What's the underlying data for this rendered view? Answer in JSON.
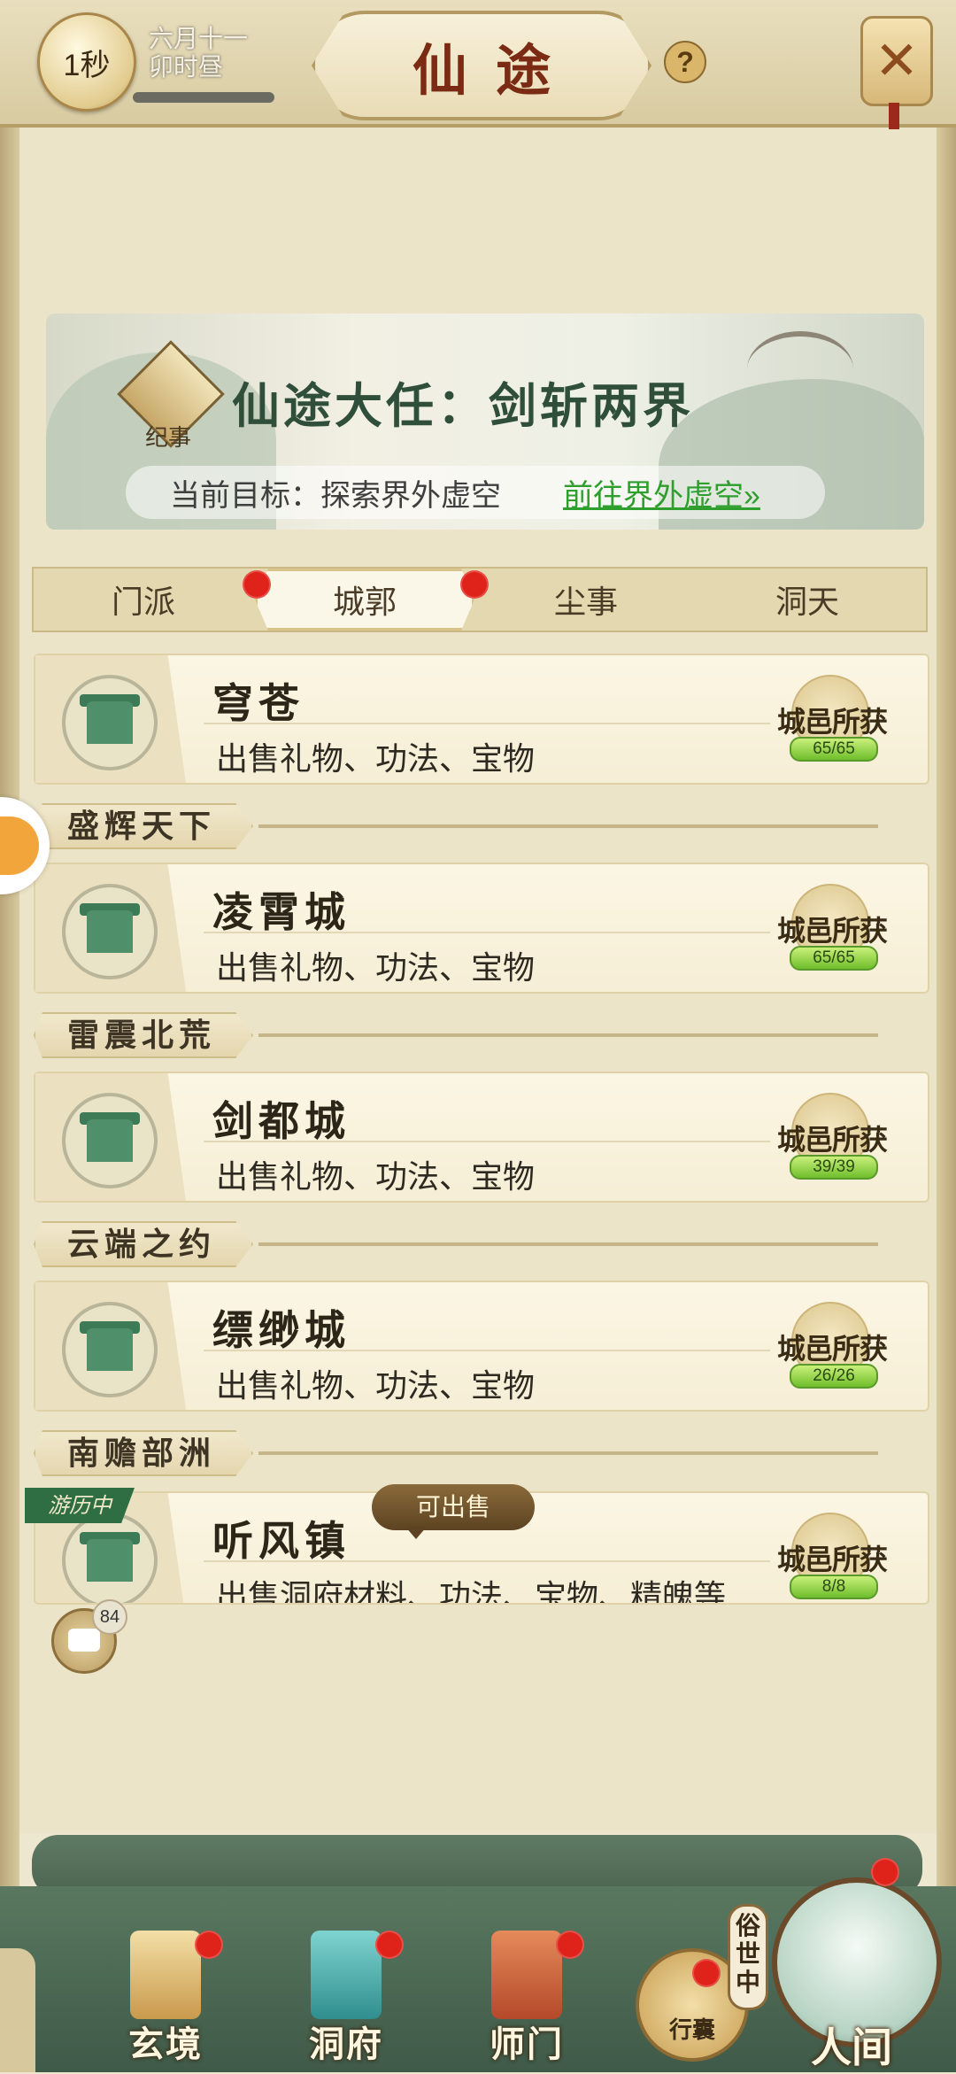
{
  "header": {
    "timer": "1秒",
    "date_line1": "六月十一",
    "date_line2": "卯时昼",
    "title": "仙途",
    "help_icon": "?",
    "close_icon": "✕"
  },
  "quest": {
    "badge": "纪事",
    "title": "仙途大任：剑斩两界",
    "goal_label": "当前目标：探索界外虚空",
    "goal_link": "前往界外虚空»"
  },
  "tabs": [
    {
      "label": "门派",
      "dot": true
    },
    {
      "label": "城郭",
      "dot": true,
      "active": true
    },
    {
      "label": "尘事",
      "dot": false
    },
    {
      "label": "洞天",
      "dot": false
    }
  ],
  "cities": [
    {
      "name": "穹苍",
      "desc": "出售礼物、功法、宝物",
      "medal": "城邑所获",
      "progress": "65/65",
      "progress_value": 1.0
    },
    {
      "region": "盛辉天下",
      "name": "凌霄城",
      "desc": "出售礼物、功法、宝物",
      "medal": "城邑所获",
      "progress": "65/65",
      "progress_value": 1.0
    },
    {
      "region": "雷震北荒",
      "name": "剑都城",
      "desc": "出售礼物、功法、宝物",
      "medal": "城邑所获",
      "progress": "39/39",
      "progress_value": 1.0
    },
    {
      "region": "云端之约",
      "name": "缥缈城",
      "desc": "出售礼物、功法、宝物",
      "medal": "城邑所获",
      "progress": "26/26",
      "progress_value": 1.0
    },
    {
      "region": "南赡部洲",
      "name": "听风镇",
      "desc": "出售洞府材料、功法、宝物、精魄等",
      "medal": "城邑所获",
      "progress": "8/8",
      "progress_value": 1.0,
      "travel_tag": "游历中",
      "sell_tag": "可出售"
    }
  ],
  "chat": {
    "count": "84"
  },
  "bottom_nav": [
    {
      "label": "玄境",
      "icon": "scroll-icon",
      "dot": true
    },
    {
      "label": "洞府",
      "icon": "pavilion-icon",
      "dot": true
    },
    {
      "label": "师门",
      "icon": "banner-icon",
      "dot": true
    }
  ],
  "bag": {
    "label": "行囊"
  },
  "world": {
    "label": "人间",
    "status": "俗世中"
  },
  "colors": {
    "accent_red": "#e0231a",
    "title_red": "#7b2b14",
    "link_green": "#2e9e2c",
    "jade_green": "#4f8f6a"
  }
}
